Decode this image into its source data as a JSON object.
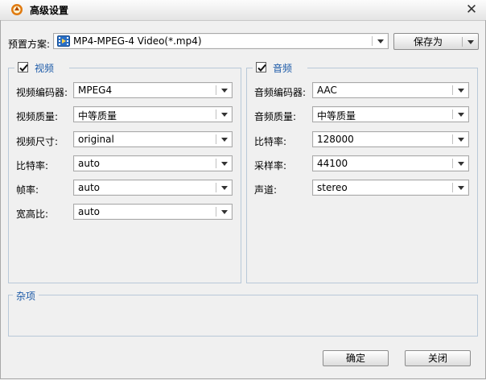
{
  "window": {
    "title": "高级设置"
  },
  "preset": {
    "label": "预置方案:",
    "value": "MP4-MPEG-4 Video(*.mp4)",
    "save_as": "保存为"
  },
  "video": {
    "legend": "视频",
    "enabled": true,
    "rows": [
      {
        "label": "视频编码器:",
        "value": "MPEG4"
      },
      {
        "label": "视频质量:",
        "value": "中等质量"
      },
      {
        "label": "视频尺寸:",
        "value": "original"
      },
      {
        "label": "比特率:",
        "value": "auto"
      },
      {
        "label": "帧率:",
        "value": "auto"
      },
      {
        "label": "宽高比:",
        "value": "auto"
      }
    ]
  },
  "audio": {
    "legend": "音频",
    "enabled": true,
    "rows": [
      {
        "label": "音频编码器:",
        "value": "AAC"
      },
      {
        "label": "音频质量:",
        "value": "中等质量"
      },
      {
        "label": "比特率:",
        "value": "128000"
      },
      {
        "label": "采样率:",
        "value": "44100"
      },
      {
        "label": "声道:",
        "value": "stereo"
      }
    ]
  },
  "misc": {
    "legend": "杂项"
  },
  "footer": {
    "ok": "确定",
    "close": "关闭"
  }
}
